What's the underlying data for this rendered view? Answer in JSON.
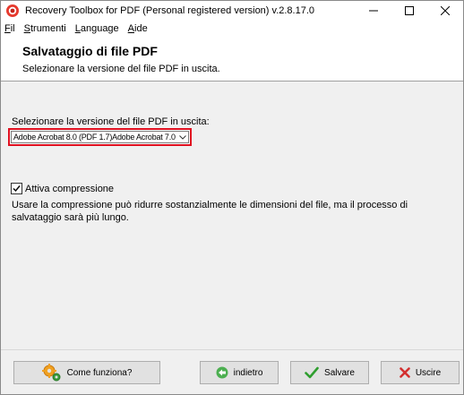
{
  "window": {
    "title": "Recovery Toolbox for PDF (Personal registered version) v.2.8.17.0",
    "controls": {
      "minimize_icon": "minimize-icon",
      "maximize_icon": "maximize-icon",
      "close_icon": "close-icon"
    }
  },
  "menu": {
    "items": [
      {
        "label": "Fil"
      },
      {
        "label": "Strumenti"
      },
      {
        "label": "Language"
      },
      {
        "label": "Aide"
      }
    ]
  },
  "header": {
    "title": "Salvataggio di file PDF",
    "subtitle": "Selezionare la versione del file PDF in uscita."
  },
  "form": {
    "select_label": "Selezionare la versione del file PDF in uscita:",
    "select_value": "Adobe Acrobat 8.0 (PDF 1.7)Adobe Acrobat 7.0 (PI",
    "highlight_color": "#e01020",
    "compression_label": "Attiva compressione",
    "compression_checked": true,
    "description": "Usare la compressione può ridurre sostanzialmente le dimensioni del file, ma il processo di salvataggio sarà più lungo."
  },
  "buttons": {
    "how": {
      "label": "Come funziona?",
      "icon": "gears-icon"
    },
    "back": {
      "label": "indietro",
      "icon": "back-arrow-icon"
    },
    "save": {
      "label": "Salvare",
      "icon": "checkmark-icon"
    },
    "exit": {
      "label": "Uscire",
      "icon": "x-icon"
    }
  }
}
